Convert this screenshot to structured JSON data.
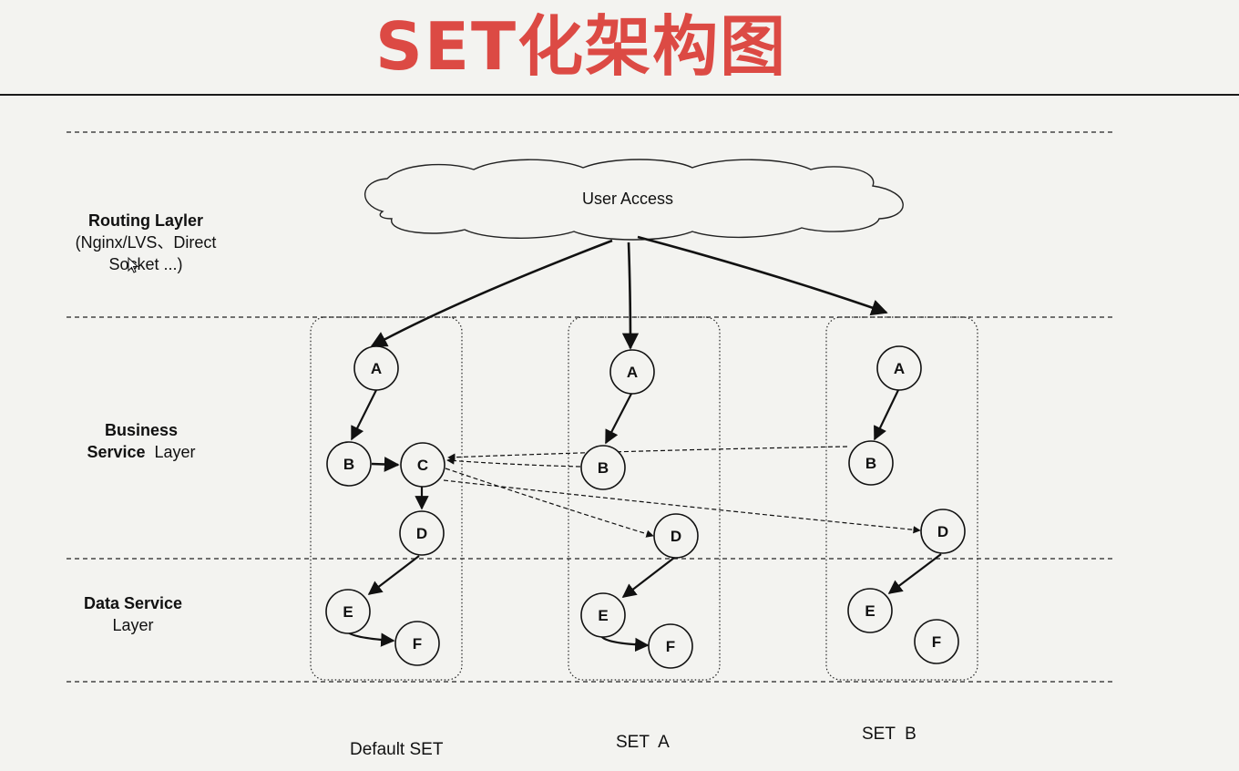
{
  "title": "SET化架构图",
  "cloud": {
    "label": "User Access"
  },
  "layers": {
    "routing": {
      "name": "Routing Layler",
      "detail_1": "(Nginx/LVS、Direct",
      "detail_2": "Socket ...)"
    },
    "business": {
      "name_1": "Business",
      "name_2": "Service",
      "name_suffix": "Layer"
    },
    "data": {
      "name": "Data Service",
      "name_2": "Layer"
    }
  },
  "sets": [
    {
      "id": "default",
      "label": "Default SET",
      "nodes": {
        "A": "A",
        "B": "B",
        "C": "C",
        "D": "D",
        "E": "E",
        "F": "F"
      }
    },
    {
      "id": "a",
      "label": "SET  A",
      "nodes": {
        "A": "A",
        "B": "B",
        "D": "D",
        "E": "E",
        "F": "F"
      }
    },
    {
      "id": "b",
      "label": "SET  B",
      "nodes": {
        "A": "A",
        "B": "B",
        "D": "D",
        "E": "E",
        "F": "F"
      }
    }
  ],
  "colors": {
    "title": "#dc4a44",
    "background": "#f3f3f0",
    "ink": "#111111"
  }
}
